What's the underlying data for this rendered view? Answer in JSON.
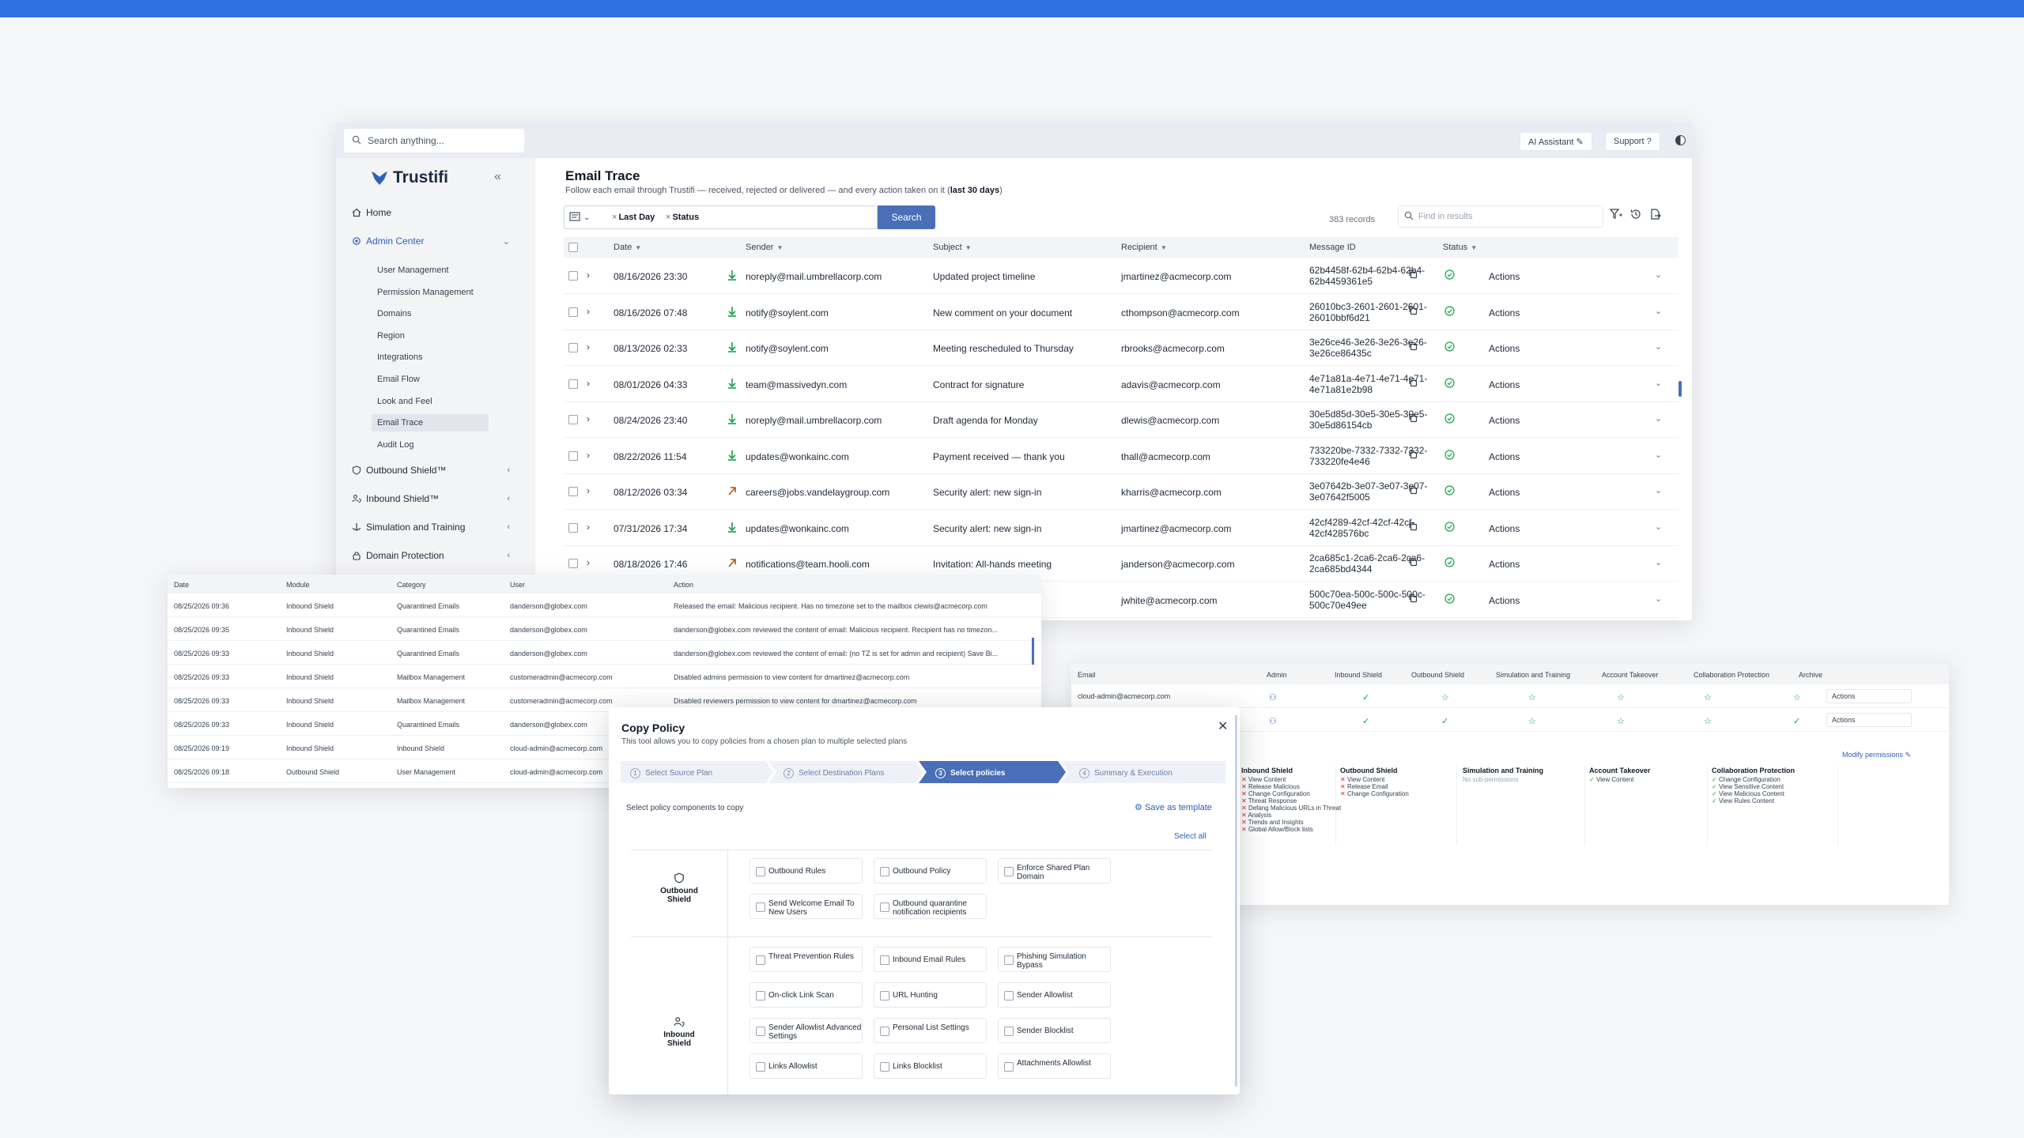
{
  "colors": {
    "accent": "#4a6fb8",
    "brand_bar": "#2f6fe4",
    "success": "#16a34a",
    "danger": "#dc2626"
  },
  "topbar": {
    "search_placeholder": "Search anything...",
    "ai_assistant": "AI Assistant",
    "support": "Support"
  },
  "sidebar": {
    "brand": "Trustifi",
    "home": "Home",
    "admin_center": "Admin Center",
    "admin_items": [
      "User Management",
      "Permission Management",
      "Domains",
      "Region",
      "Integrations",
      "Email Flow",
      "Look and Feel",
      "Email Trace",
      "Audit Log"
    ],
    "active_item": "Email Trace",
    "outbound": "Outbound Shield™",
    "inbound": "Inbound Shield™",
    "simulation": "Simulation and Training",
    "domain_protection": "Domain Protection"
  },
  "trace": {
    "title": "Email Trace",
    "subtitle_main": "Follow each email through Trustifi — received, rejected or delivered — and every action taken on it (",
    "subtitle_bold": "last 30 days",
    "subtitle_end": ")",
    "chips": [
      "Last Day",
      "Status"
    ],
    "search_btn": "Search",
    "records": "383 records",
    "find_placeholder": "Find in results",
    "columns": [
      "Date",
      "Sender",
      "Subject",
      "Recipient",
      "Message ID",
      "Status"
    ],
    "action_label": "Actions",
    "rows": [
      {
        "date": "08/16/2026 23:30",
        "dir": "in",
        "sender": "noreply@mail.umbrellacorp.com",
        "subject": "Updated project timeline",
        "recipient": "jmartinez@acmecorp.com",
        "id1": "62b4458f-62b4-62b4-62b4-",
        "id2": "62b4459361e5"
      },
      {
        "date": "08/16/2026 07:48",
        "dir": "in",
        "sender": "notify@soylent.com",
        "subject": "New comment on your document",
        "recipient": "cthompson@acmecorp.com",
        "id1": "26010bc3-2601-2601-2601-",
        "id2": "26010bbf6d21"
      },
      {
        "date": "08/13/2026 02:33",
        "dir": "in",
        "sender": "notify@soylent.com",
        "subject": "Meeting rescheduled to Thursday",
        "recipient": "rbrooks@acmecorp.com",
        "id1": "3e26ce46-3e26-3e26-3e26-",
        "id2": "3e26ce86435c"
      },
      {
        "date": "08/01/2026 04:33",
        "dir": "in",
        "sender": "team@massivedyn.com",
        "subject": "Contract for signature",
        "recipient": "adavis@acmecorp.com",
        "id1": "4e71a81a-4e71-4e71-4e71-",
        "id2": "4e71a81e2b98"
      },
      {
        "date": "08/24/2026 23:40",
        "dir": "in",
        "sender": "noreply@mail.umbrellacorp.com",
        "subject": "Draft agenda for Monday",
        "recipient": "dlewis@acmecorp.com",
        "id1": "30e5d85d-30e5-30e5-30e5-",
        "id2": "30e5d86154cb"
      },
      {
        "date": "08/22/2026 11:54",
        "dir": "in",
        "sender": "updates@wonkainc.com",
        "subject": "Payment received — thank you",
        "recipient": "thall@acmecorp.com",
        "id1": "733220be-7332-7332-7332-",
        "id2": "733220fe4e46"
      },
      {
        "date": "08/12/2026 03:34",
        "dir": "out",
        "sender": "careers@jobs.vandelaygroup.com",
        "subject": "Security alert: new sign-in",
        "recipient": "kharris@acmecorp.com",
        "id1": "3e07642b-3e07-3e07-3e07-",
        "id2": "3e07642f5005"
      },
      {
        "date": "07/31/2026 17:34",
        "dir": "in",
        "sender": "updates@wonkainc.com",
        "subject": "Security alert: new sign-in",
        "recipient": "jmartinez@acmecorp.com",
        "id1": "42cf4289-42cf-42cf-42cf-",
        "id2": "42cf428576bc"
      },
      {
        "date": "08/18/2026 17:46",
        "dir": "out",
        "sender": "notifications@team.hooli.com",
        "subject": "Invitation: All-hands meeting",
        "recipient": "janderson@acmecorp.com",
        "id1": "2ca685c1-2ca6-2ca6-2ca6-",
        "id2": "2ca685bd4344"
      },
      {
        "date": "",
        "dir": "",
        "sender": "",
        "subject": "",
        "recipient": "jwhite@acmecorp.com",
        "id1": "500c70ea-500c-500c-500c-",
        "id2": "500c70e49ee"
      }
    ]
  },
  "audit": {
    "columns": [
      "Date",
      "Module",
      "Category",
      "User",
      "Action"
    ],
    "rows": [
      {
        "date": "08/25/2026 09:36",
        "module": "Inbound Shield",
        "category": "Quarantined Emails",
        "user": "danderson@globex.com",
        "action": "Released the email: Malicious recipient. Has no timezone set to the mailbox clewis@acmecorp.com"
      },
      {
        "date": "08/25/2026 09:35",
        "module": "Inbound Shield",
        "category": "Quarantined Emails",
        "user": "danderson@globex.com",
        "action": "danderson@globex.com reviewed the content of email: Malicious recipient. Recipient has no timezon..."
      },
      {
        "date": "08/25/2026 09:33",
        "module": "Inbound Shield",
        "category": "Quarantined Emails",
        "user": "danderson@globex.com",
        "action": "danderson@globex.com reviewed the content of email: (no TZ is set for admin and recipient) Save Bi..."
      },
      {
        "date": "08/25/2026 09:33",
        "module": "Inbound Shield",
        "category": "Mailbox Management",
        "user": "customeradmin@acmecorp.com",
        "action": "Disabled admins permission to view content for dmartinez@acmecorp.com"
      },
      {
        "date": "08/25/2026 09:33",
        "module": "Inbound Shield",
        "category": "Mailbox Management",
        "user": "customeradmin@acmecorp.com",
        "action": "Disabled reviewers permission to view content for dmartinez@acmecorp.com"
      },
      {
        "date": "08/25/2026 09:33",
        "module": "Inbound Shield",
        "category": "Quarantined Emails",
        "user": "danderson@globex.com",
        "action": ""
      },
      {
        "date": "08/25/2026 09:19",
        "module": "Inbound Shield",
        "category": "Inbound Shield",
        "user": "cloud-admin@acmecorp.com",
        "action": ""
      },
      {
        "date": "08/25/2026 09:18",
        "module": "Outbound Shield",
        "category": "User Management",
        "user": "cloud-admin@acmecorp.com",
        "action": ""
      }
    ]
  },
  "perms": {
    "columns": [
      "Email",
      "Admin",
      "Inbound Shield",
      "Outbound Shield",
      "Simulation and Training",
      "Account Takeover",
      "Collaboration Protection",
      "Archive"
    ],
    "rows": [
      {
        "email": "cloud-admin@acmecorp.com",
        "action": "Actions"
      },
      {
        "email": "",
        "action": "Actions"
      }
    ],
    "modify": "Modify permissions",
    "cards": [
      {
        "title": "Inbound Shield",
        "items": [
          "View Content",
          "Release Malicious",
          "Change Configuration",
          "Threat Response",
          "Defang Malicious URLs in Threat",
          "Analysis",
          "Trends and Insights",
          "Global Allow/Block lists"
        ]
      },
      {
        "title": "Outbound Shield",
        "items": [
          "View Content",
          "Release Email",
          "Change Configuration"
        ]
      },
      {
        "title": "Simulation and Training",
        "items": [
          "No sub-permissions"
        ]
      },
      {
        "title": "Account Takeover",
        "items": [
          "View Content"
        ]
      },
      {
        "title": "Collaboration Protection",
        "items": [
          "Change Configuration",
          "View Sensitive Content",
          "View Malicious Content",
          "View Rules Content"
        ]
      }
    ]
  },
  "modal": {
    "title": "Copy Policy",
    "subtitle": "This tool allows you to copy policies from a chosen plan to multiple selected plans",
    "steps": [
      {
        "n": "1",
        "label": "Select Source Plan"
      },
      {
        "n": "2",
        "label": "Select Destination Plans"
      },
      {
        "n": "3",
        "label": "Select policies"
      },
      {
        "n": "4",
        "label": "Summary & Execution"
      }
    ],
    "components_label": "Select policy components to copy",
    "save_template": "Save as template",
    "select_all": "Select all",
    "outbound_label": "Outbound Shield",
    "outbound_opts": [
      "Outbound Rules",
      "Outbound Policy",
      "Enforce Shared Plan Domain",
      "Send Welcome Email To New Users",
      "Outbound quarantine notification recipients"
    ],
    "inbound_label": "Inbound Shield",
    "inbound_opts": [
      "Threat Prevention Rules",
      "Inbound Email Rules",
      "Phishing Simulation Bypass",
      "On-click Link Scan",
      "URL Hunting",
      "Sender Allowlist",
      "Sender Allowlist Advanced Settings",
      "Personal List Settings",
      "Sender Blocklist",
      "Links Allowlist",
      "Links Blocklist",
      "Attachments Allowlist"
    ]
  }
}
